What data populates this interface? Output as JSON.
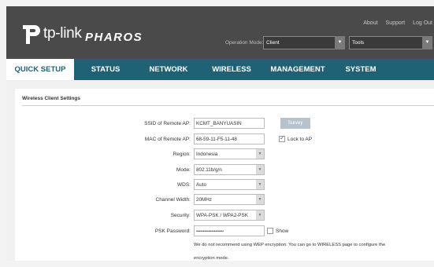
{
  "header": {
    "brand": "tp-link",
    "product": "PHAROS",
    "links": [
      "About",
      "Support",
      "Log Out"
    ],
    "operation_mode_label": "Operation Mode:",
    "operation_mode_value": "Client",
    "tools_value": "Tools"
  },
  "nav": {
    "tabs": [
      "QUICK SETUP",
      "STATUS",
      "NETWORK",
      "WIRELESS",
      "MANAGEMENT",
      "SYSTEM"
    ],
    "active": "QUICK SETUP"
  },
  "form": {
    "section_title": "Wireless Client Settings",
    "ssid_label": "SSID of Remote AP:",
    "ssid_value": "KCMT_BANYUASIN",
    "survey_label": "Survey",
    "mac_label": "MAC of Remote AP:",
    "mac_value": "68-59-11-F5-11-48",
    "lock_label": "Lock to AP",
    "lock_checked": true,
    "region_label": "Region:",
    "region_value": "Indonesia",
    "mode_label": "Mode:",
    "mode_value": "802.11b/g/n",
    "wds_label": "WDS:",
    "wds_value": "Auto",
    "channel_width_label": "Channel Width:",
    "channel_width_value": "20MHz",
    "security_label": "Security:",
    "security_value": "WPA-PSK / WPA2-PSK",
    "psk_label": "PSK Password:",
    "psk_value": "••••••••••••••••••••",
    "show_label": "Show",
    "show_checked": false,
    "note_line1": "We do not recommend using WEP encryption. You can go to WIRELESS page to configure the",
    "note_line2": "encryption mode."
  },
  "colors": {
    "header_bg": "#4a4a4a",
    "nav_bg": "#1f6175",
    "survey_button": "#b6c3cc"
  }
}
